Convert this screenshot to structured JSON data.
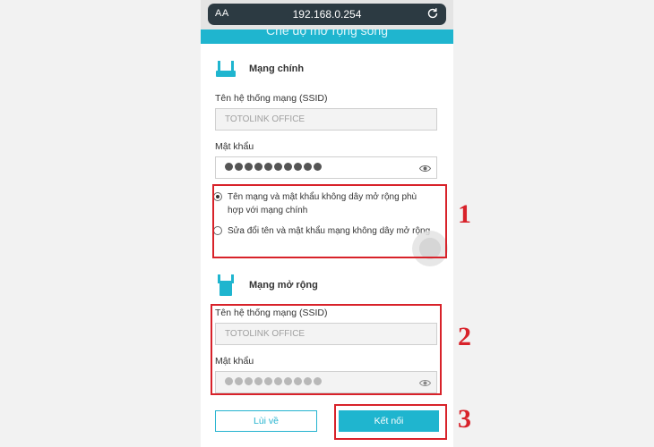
{
  "browser": {
    "aa_label": "AA",
    "url": "192.168.0.254"
  },
  "page": {
    "header_title": "Chế độ mở rộng sóng"
  },
  "main_network": {
    "title": "Mạng chính",
    "ssid_label": "Tên hệ thống mạng (SSID)",
    "ssid_value": "TOTOLINK OFFICE",
    "password_label": "Mật khẩu"
  },
  "extend_options": [
    {
      "label": "Tên mạng và mật khẩu không dây mở rộng phù hợp với mạng chính",
      "selected": true
    },
    {
      "label": "Sửa đổi tên và mật khẩu mạng không dây mở rộng",
      "selected": false
    }
  ],
  "extended_network": {
    "title": "Mạng mở rộng",
    "ssid_label": "Tên hệ thống mạng (SSID)",
    "ssid_value": "TOTOLINK OFFICE",
    "password_label": "Mật khẩu"
  },
  "buttons": {
    "back": "Lùi về",
    "connect": "Kết nối"
  },
  "annotations": [
    "1",
    "2",
    "3"
  ],
  "colors": {
    "accent": "#1fb5cf",
    "annotation_red": "#d8222a"
  }
}
